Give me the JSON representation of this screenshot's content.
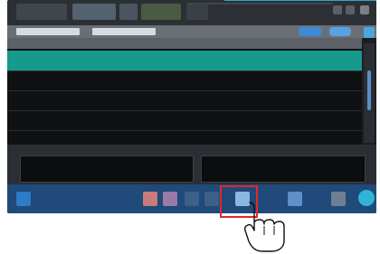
{
  "top_bar": {
    "logo_text": "",
    "icons": [
      "tab-icon",
      "list-icon",
      "window-minimize-icon",
      "window-restore-icon",
      "window-close-icon"
    ]
  },
  "search": {
    "field1_placeholder": "",
    "field2_placeholder": "",
    "button1_label": "",
    "button2_label": ""
  },
  "table": {
    "headers": [
      "",
      "",
      "",
      "",
      "",
      "",
      "",
      ""
    ],
    "rows": [
      {
        "cells": [
          "",
          "",
          "",
          "",
          "",
          "",
          "",
          ""
        ],
        "selected": true
      },
      {
        "cells": [
          "",
          "",
          "",
          "",
          "",
          "",
          "",
          ""
        ],
        "selected": false
      },
      {
        "cells": [
          "",
          "",
          "",
          "",
          "",
          "",
          "",
          ""
        ],
        "selected": false
      },
      {
        "cells": [
          "",
          "",
          "",
          "",
          "",
          "",
          "",
          ""
        ],
        "selected": false
      },
      {
        "cells": [
          "",
          "",
          "",
          "",
          "",
          "",
          "",
          ""
        ],
        "selected": false
      }
    ]
  },
  "preview": {
    "title": "",
    "thumb1_text": "",
    "thumb2_text": ""
  },
  "bottom_toolbar": {
    "icons": [
      "home-icon",
      "image-icon",
      "film-icon",
      "copy-icon",
      "layout-icon",
      "target-icon",
      "print-icon",
      "pause-icon",
      "exit-icon"
    ]
  },
  "colors": {
    "selected_row": "#159a8c",
    "toolbar": "#1f4a7a",
    "highlight": "#e3262a",
    "accent": "#3d8bd6"
  },
  "annotations": {
    "highlight_icon": "highlight-box",
    "hand_icon": "hand-pointer-icon"
  }
}
